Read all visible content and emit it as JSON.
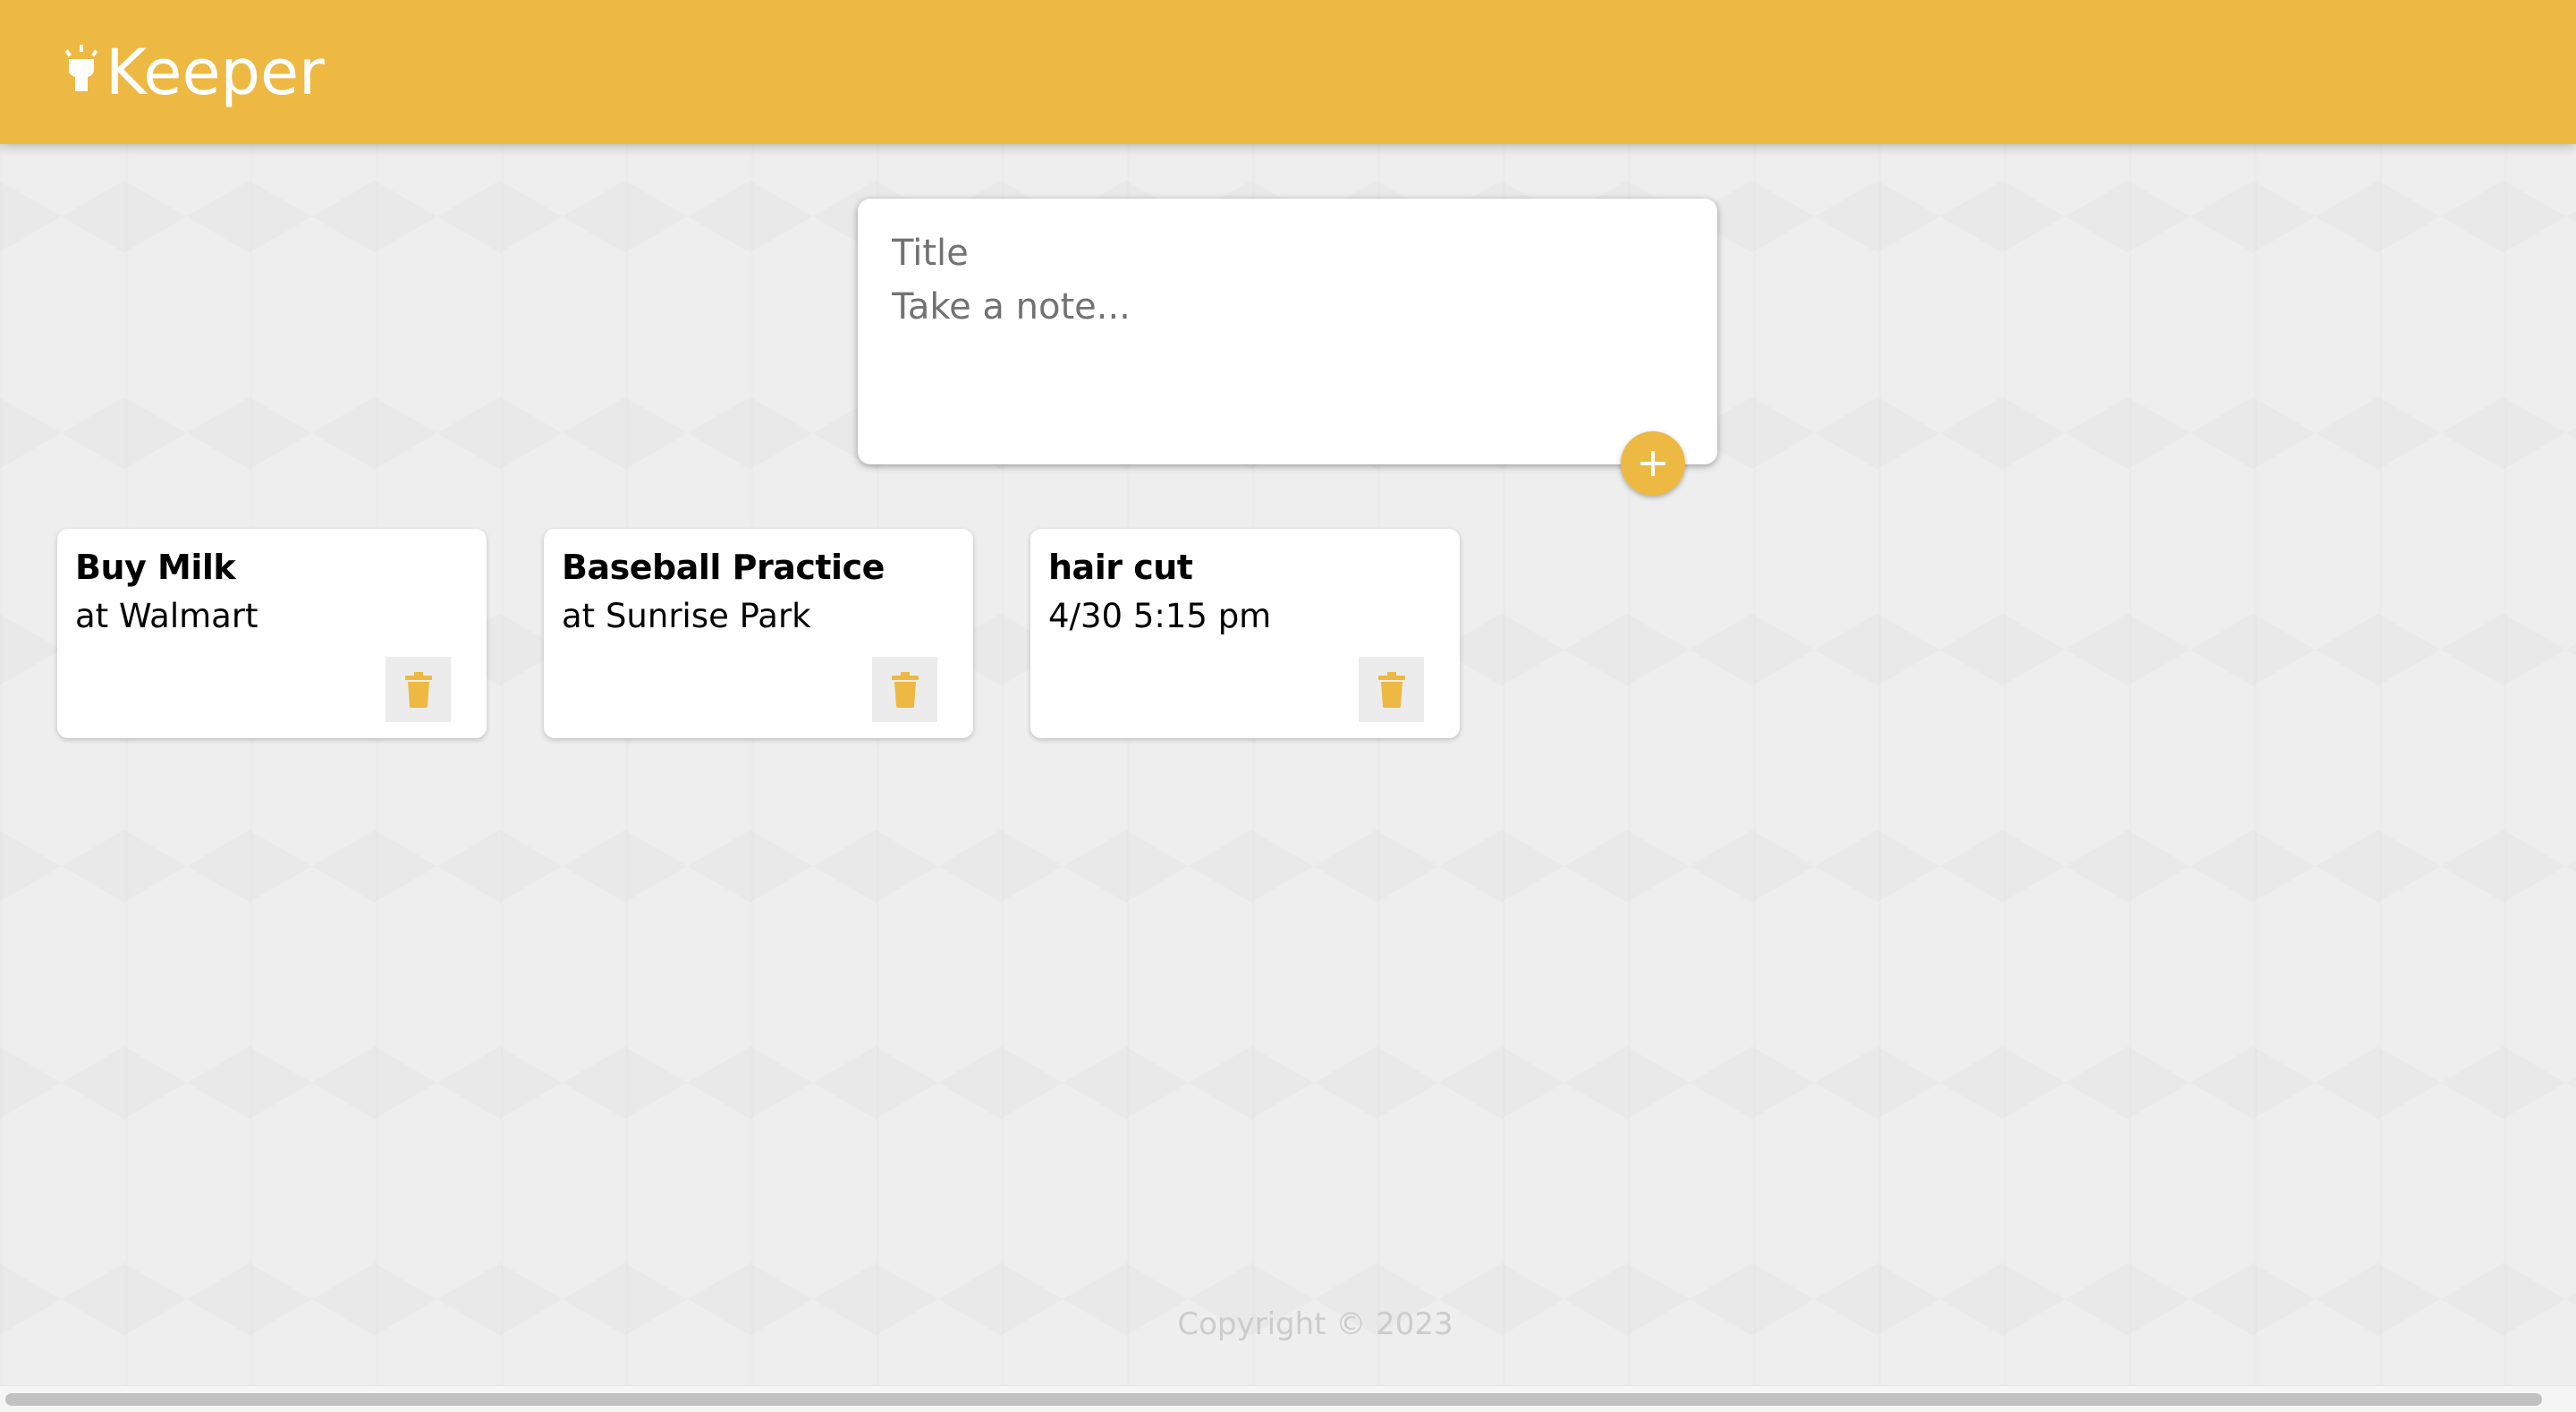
{
  "header": {
    "title": "Keeper",
    "logo_icon": "lightbulb-icon"
  },
  "create_note": {
    "title_placeholder": "Title",
    "content_placeholder": "Take a note...",
    "add_icon": "plus-icon"
  },
  "notes": [
    {
      "title": "Buy Milk",
      "content": "at Walmart",
      "delete_icon": "trash-icon"
    },
    {
      "title": "Baseball Practice",
      "content": "at Sunrise Park",
      "delete_icon": "trash-icon"
    },
    {
      "title": "hair cut",
      "content": "4/30 5:15 pm",
      "delete_icon": "trash-icon"
    }
  ],
  "footer": {
    "copyright": "Copyright © 2023"
  },
  "colors": {
    "accent": "#edb942",
    "background": "#eeeeee",
    "card": "#ffffff"
  }
}
